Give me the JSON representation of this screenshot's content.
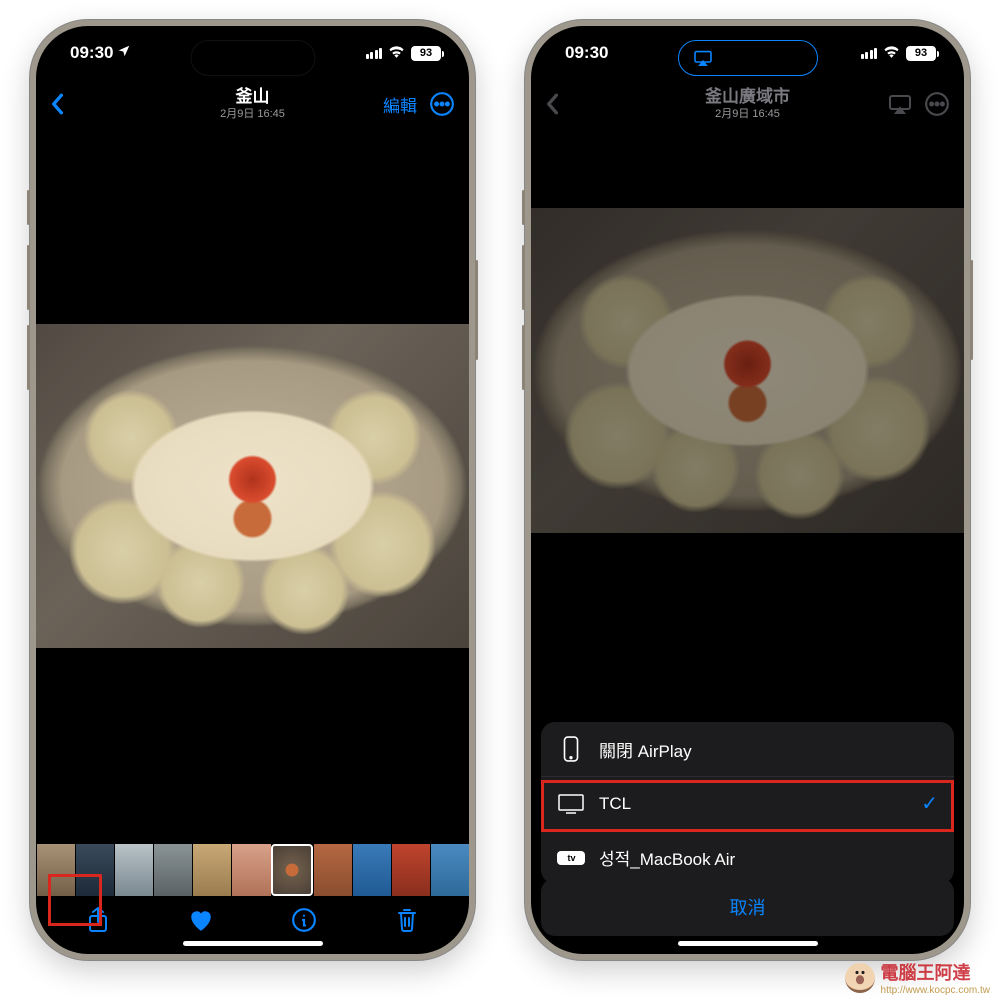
{
  "status": {
    "time": "09:30",
    "battery": "93"
  },
  "left_screen": {
    "nav": {
      "title": "釜山",
      "subtitle": "2月9日 16:45",
      "edit": "編輯"
    }
  },
  "right_screen": {
    "nav": {
      "title": "釜山廣域市",
      "subtitle": "2月9日 16:45"
    },
    "airplay": {
      "off": "關閉 AirPlay",
      "device1": "TCL",
      "device2": "성적_MacBook Air",
      "cancel": "取消"
    }
  },
  "watermark": {
    "name": "電腦王阿達",
    "url": "http://www.kocpc.com.tw"
  }
}
